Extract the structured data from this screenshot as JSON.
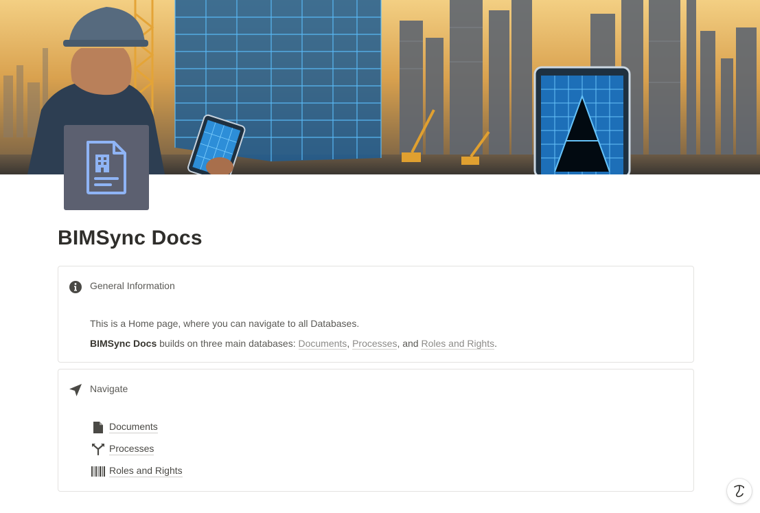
{
  "page": {
    "title": "BIMSync Docs",
    "cover": {
      "alt": "Construction worker with tablet viewing wireframe buildings at sunset",
      "sky_color": "#e9b45e",
      "blueprint_color": "#4fb3ff"
    },
    "icon": {
      "name": "building-document-icon",
      "bg_color": "#5c6070",
      "fg_color": "#8fb4f5"
    }
  },
  "info_callout": {
    "icon": "info-icon",
    "heading": "General Information",
    "line1": "This is a Home page, where you can navigate to all Databases.",
    "line2_bold": "BIMSync Docs",
    "line2_text": " builds on three main databases: ",
    "link1": "Documents",
    "sep1": ", ",
    "link2": "Processes",
    "sep2": ", and ",
    "link3": "Roles and Rights",
    "end": "."
  },
  "nav_callout": {
    "icon": "navigation-arrow-icon",
    "heading": "Navigate",
    "items": [
      {
        "icon": "document-icon",
        "label": "Documents"
      },
      {
        "icon": "process-branch-icon",
        "label": "Processes"
      },
      {
        "icon": "barcode-icon",
        "label": "Roles and Rights"
      }
    ]
  },
  "floating_button": {
    "icon": "help-icon"
  }
}
